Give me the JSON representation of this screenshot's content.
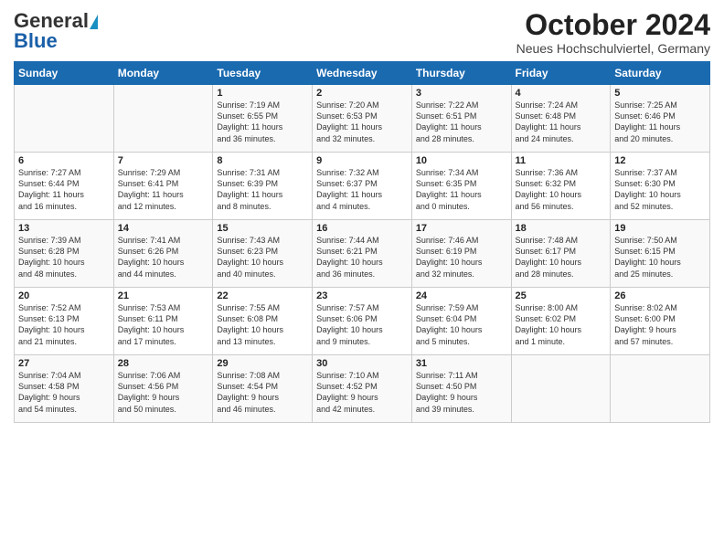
{
  "header": {
    "logo_general": "General",
    "logo_blue": "Blue",
    "title": "October 2024",
    "location": "Neues Hochschulviertel, Germany"
  },
  "days_of_week": [
    "Sunday",
    "Monday",
    "Tuesday",
    "Wednesday",
    "Thursday",
    "Friday",
    "Saturday"
  ],
  "weeks": [
    [
      {
        "day": "",
        "content": ""
      },
      {
        "day": "",
        "content": ""
      },
      {
        "day": "1",
        "content": "Sunrise: 7:19 AM\nSunset: 6:55 PM\nDaylight: 11 hours\nand 36 minutes."
      },
      {
        "day": "2",
        "content": "Sunrise: 7:20 AM\nSunset: 6:53 PM\nDaylight: 11 hours\nand 32 minutes."
      },
      {
        "day": "3",
        "content": "Sunrise: 7:22 AM\nSunset: 6:51 PM\nDaylight: 11 hours\nand 28 minutes."
      },
      {
        "day": "4",
        "content": "Sunrise: 7:24 AM\nSunset: 6:48 PM\nDaylight: 11 hours\nand 24 minutes."
      },
      {
        "day": "5",
        "content": "Sunrise: 7:25 AM\nSunset: 6:46 PM\nDaylight: 11 hours\nand 20 minutes."
      }
    ],
    [
      {
        "day": "6",
        "content": "Sunrise: 7:27 AM\nSunset: 6:44 PM\nDaylight: 11 hours\nand 16 minutes."
      },
      {
        "day": "7",
        "content": "Sunrise: 7:29 AM\nSunset: 6:41 PM\nDaylight: 11 hours\nand 12 minutes."
      },
      {
        "day": "8",
        "content": "Sunrise: 7:31 AM\nSunset: 6:39 PM\nDaylight: 11 hours\nand 8 minutes."
      },
      {
        "day": "9",
        "content": "Sunrise: 7:32 AM\nSunset: 6:37 PM\nDaylight: 11 hours\nand 4 minutes."
      },
      {
        "day": "10",
        "content": "Sunrise: 7:34 AM\nSunset: 6:35 PM\nDaylight: 11 hours\nand 0 minutes."
      },
      {
        "day": "11",
        "content": "Sunrise: 7:36 AM\nSunset: 6:32 PM\nDaylight: 10 hours\nand 56 minutes."
      },
      {
        "day": "12",
        "content": "Sunrise: 7:37 AM\nSunset: 6:30 PM\nDaylight: 10 hours\nand 52 minutes."
      }
    ],
    [
      {
        "day": "13",
        "content": "Sunrise: 7:39 AM\nSunset: 6:28 PM\nDaylight: 10 hours\nand 48 minutes."
      },
      {
        "day": "14",
        "content": "Sunrise: 7:41 AM\nSunset: 6:26 PM\nDaylight: 10 hours\nand 44 minutes."
      },
      {
        "day": "15",
        "content": "Sunrise: 7:43 AM\nSunset: 6:23 PM\nDaylight: 10 hours\nand 40 minutes."
      },
      {
        "day": "16",
        "content": "Sunrise: 7:44 AM\nSunset: 6:21 PM\nDaylight: 10 hours\nand 36 minutes."
      },
      {
        "day": "17",
        "content": "Sunrise: 7:46 AM\nSunset: 6:19 PM\nDaylight: 10 hours\nand 32 minutes."
      },
      {
        "day": "18",
        "content": "Sunrise: 7:48 AM\nSunset: 6:17 PM\nDaylight: 10 hours\nand 28 minutes."
      },
      {
        "day": "19",
        "content": "Sunrise: 7:50 AM\nSunset: 6:15 PM\nDaylight: 10 hours\nand 25 minutes."
      }
    ],
    [
      {
        "day": "20",
        "content": "Sunrise: 7:52 AM\nSunset: 6:13 PM\nDaylight: 10 hours\nand 21 minutes."
      },
      {
        "day": "21",
        "content": "Sunrise: 7:53 AM\nSunset: 6:11 PM\nDaylight: 10 hours\nand 17 minutes."
      },
      {
        "day": "22",
        "content": "Sunrise: 7:55 AM\nSunset: 6:08 PM\nDaylight: 10 hours\nand 13 minutes."
      },
      {
        "day": "23",
        "content": "Sunrise: 7:57 AM\nSunset: 6:06 PM\nDaylight: 10 hours\nand 9 minutes."
      },
      {
        "day": "24",
        "content": "Sunrise: 7:59 AM\nSunset: 6:04 PM\nDaylight: 10 hours\nand 5 minutes."
      },
      {
        "day": "25",
        "content": "Sunrise: 8:00 AM\nSunset: 6:02 PM\nDaylight: 10 hours\nand 1 minute."
      },
      {
        "day": "26",
        "content": "Sunrise: 8:02 AM\nSunset: 6:00 PM\nDaylight: 9 hours\nand 57 minutes."
      }
    ],
    [
      {
        "day": "27",
        "content": "Sunrise: 7:04 AM\nSunset: 4:58 PM\nDaylight: 9 hours\nand 54 minutes."
      },
      {
        "day": "28",
        "content": "Sunrise: 7:06 AM\nSunset: 4:56 PM\nDaylight: 9 hours\nand 50 minutes."
      },
      {
        "day": "29",
        "content": "Sunrise: 7:08 AM\nSunset: 4:54 PM\nDaylight: 9 hours\nand 46 minutes."
      },
      {
        "day": "30",
        "content": "Sunrise: 7:10 AM\nSunset: 4:52 PM\nDaylight: 9 hours\nand 42 minutes."
      },
      {
        "day": "31",
        "content": "Sunrise: 7:11 AM\nSunset: 4:50 PM\nDaylight: 9 hours\nand 39 minutes."
      },
      {
        "day": "",
        "content": ""
      },
      {
        "day": "",
        "content": ""
      }
    ]
  ]
}
